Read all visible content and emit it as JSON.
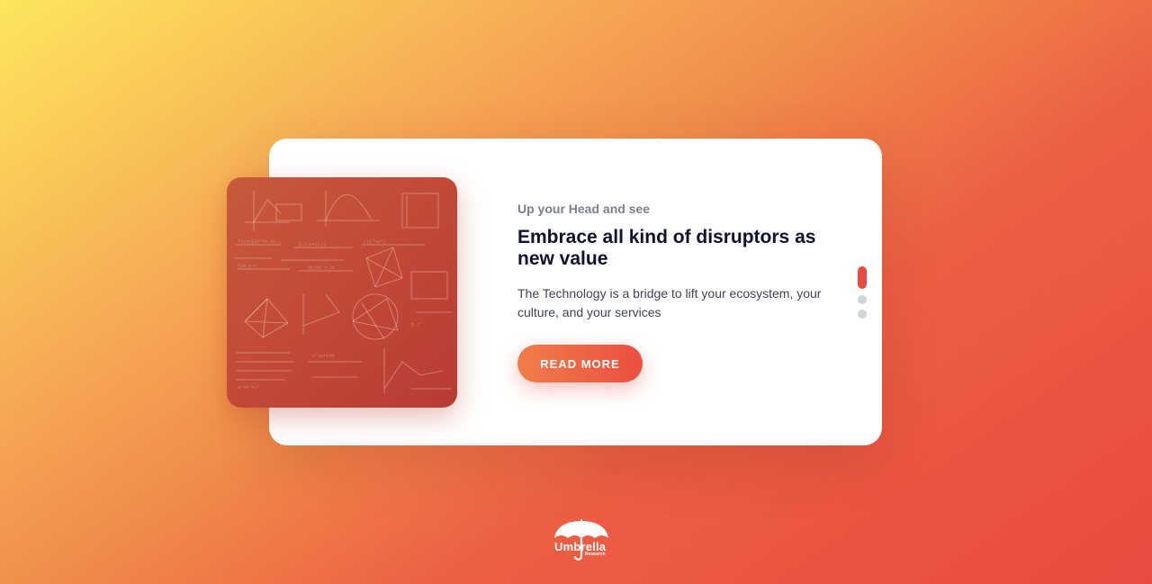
{
  "slide": {
    "eyebrow": "Up your Head and see",
    "headline": "Embrace all kind of disruptors as new value",
    "description": "The Technology is a bridge to lift your ecosystem, your culture, and your services",
    "cta_label": "READ MORE"
  },
  "pagination": {
    "total": 3,
    "active_index": 0
  },
  "brand": {
    "name": "Umbrella",
    "tagline": "Research"
  },
  "colors": {
    "accent": "#ea4b40",
    "headline": "#0e1130",
    "muted": "#7b7f92"
  },
  "icons": {
    "logo": "umbrella-icon",
    "image": "math-formulas-illustration"
  }
}
